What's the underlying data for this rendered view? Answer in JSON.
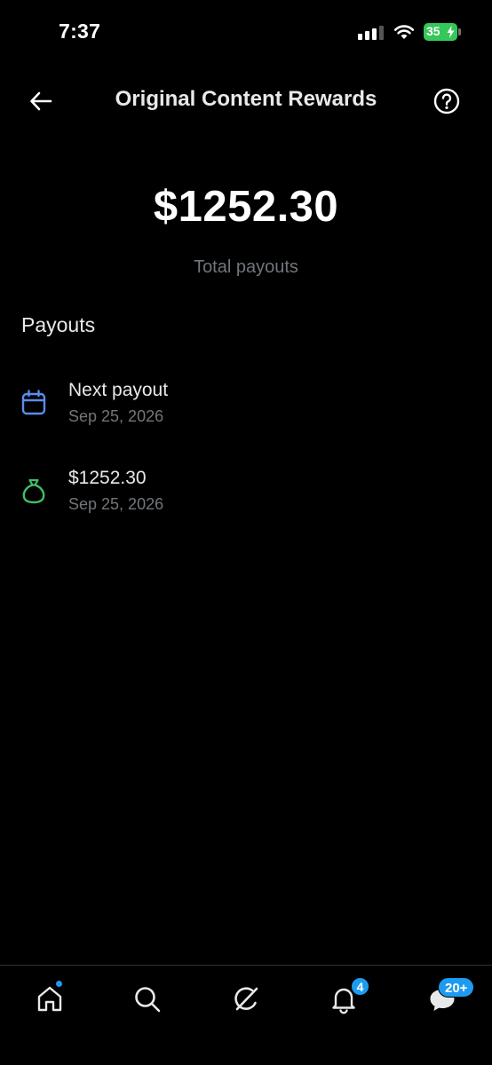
{
  "status_bar": {
    "time": "7:37",
    "battery": "35"
  },
  "header": {
    "title": "Original Content Rewards",
    "back_icon": "arrow-left-icon",
    "help_icon": "question-circle-icon"
  },
  "summary": {
    "total_amount": "$1252.30",
    "total_label": "Total payouts"
  },
  "payouts": {
    "heading": "Payouts",
    "items": [
      {
        "icon": "calendar-icon",
        "icon_color": "#5b8def",
        "title": "Next payout",
        "date": "Sep 25, 2026"
      },
      {
        "icon": "money-bag-icon",
        "icon_color": "#3fbf6b",
        "title": "$1252.30",
        "date": "Sep 25, 2026"
      }
    ]
  },
  "bottom_nav": {
    "items": [
      {
        "name": "home",
        "icon": "home-icon"
      },
      {
        "name": "search",
        "icon": "search-icon"
      },
      {
        "name": "grok",
        "icon": "grok-icon"
      },
      {
        "name": "notifications",
        "icon": "bell-icon",
        "badge": "4"
      },
      {
        "name": "messages",
        "icon": "message-icon",
        "badge": "20+"
      }
    ]
  },
  "colors": {
    "background": "#000000",
    "accent": "#1d9bf0",
    "muted_text": "#71767b",
    "battery_green": "#34c759"
  }
}
